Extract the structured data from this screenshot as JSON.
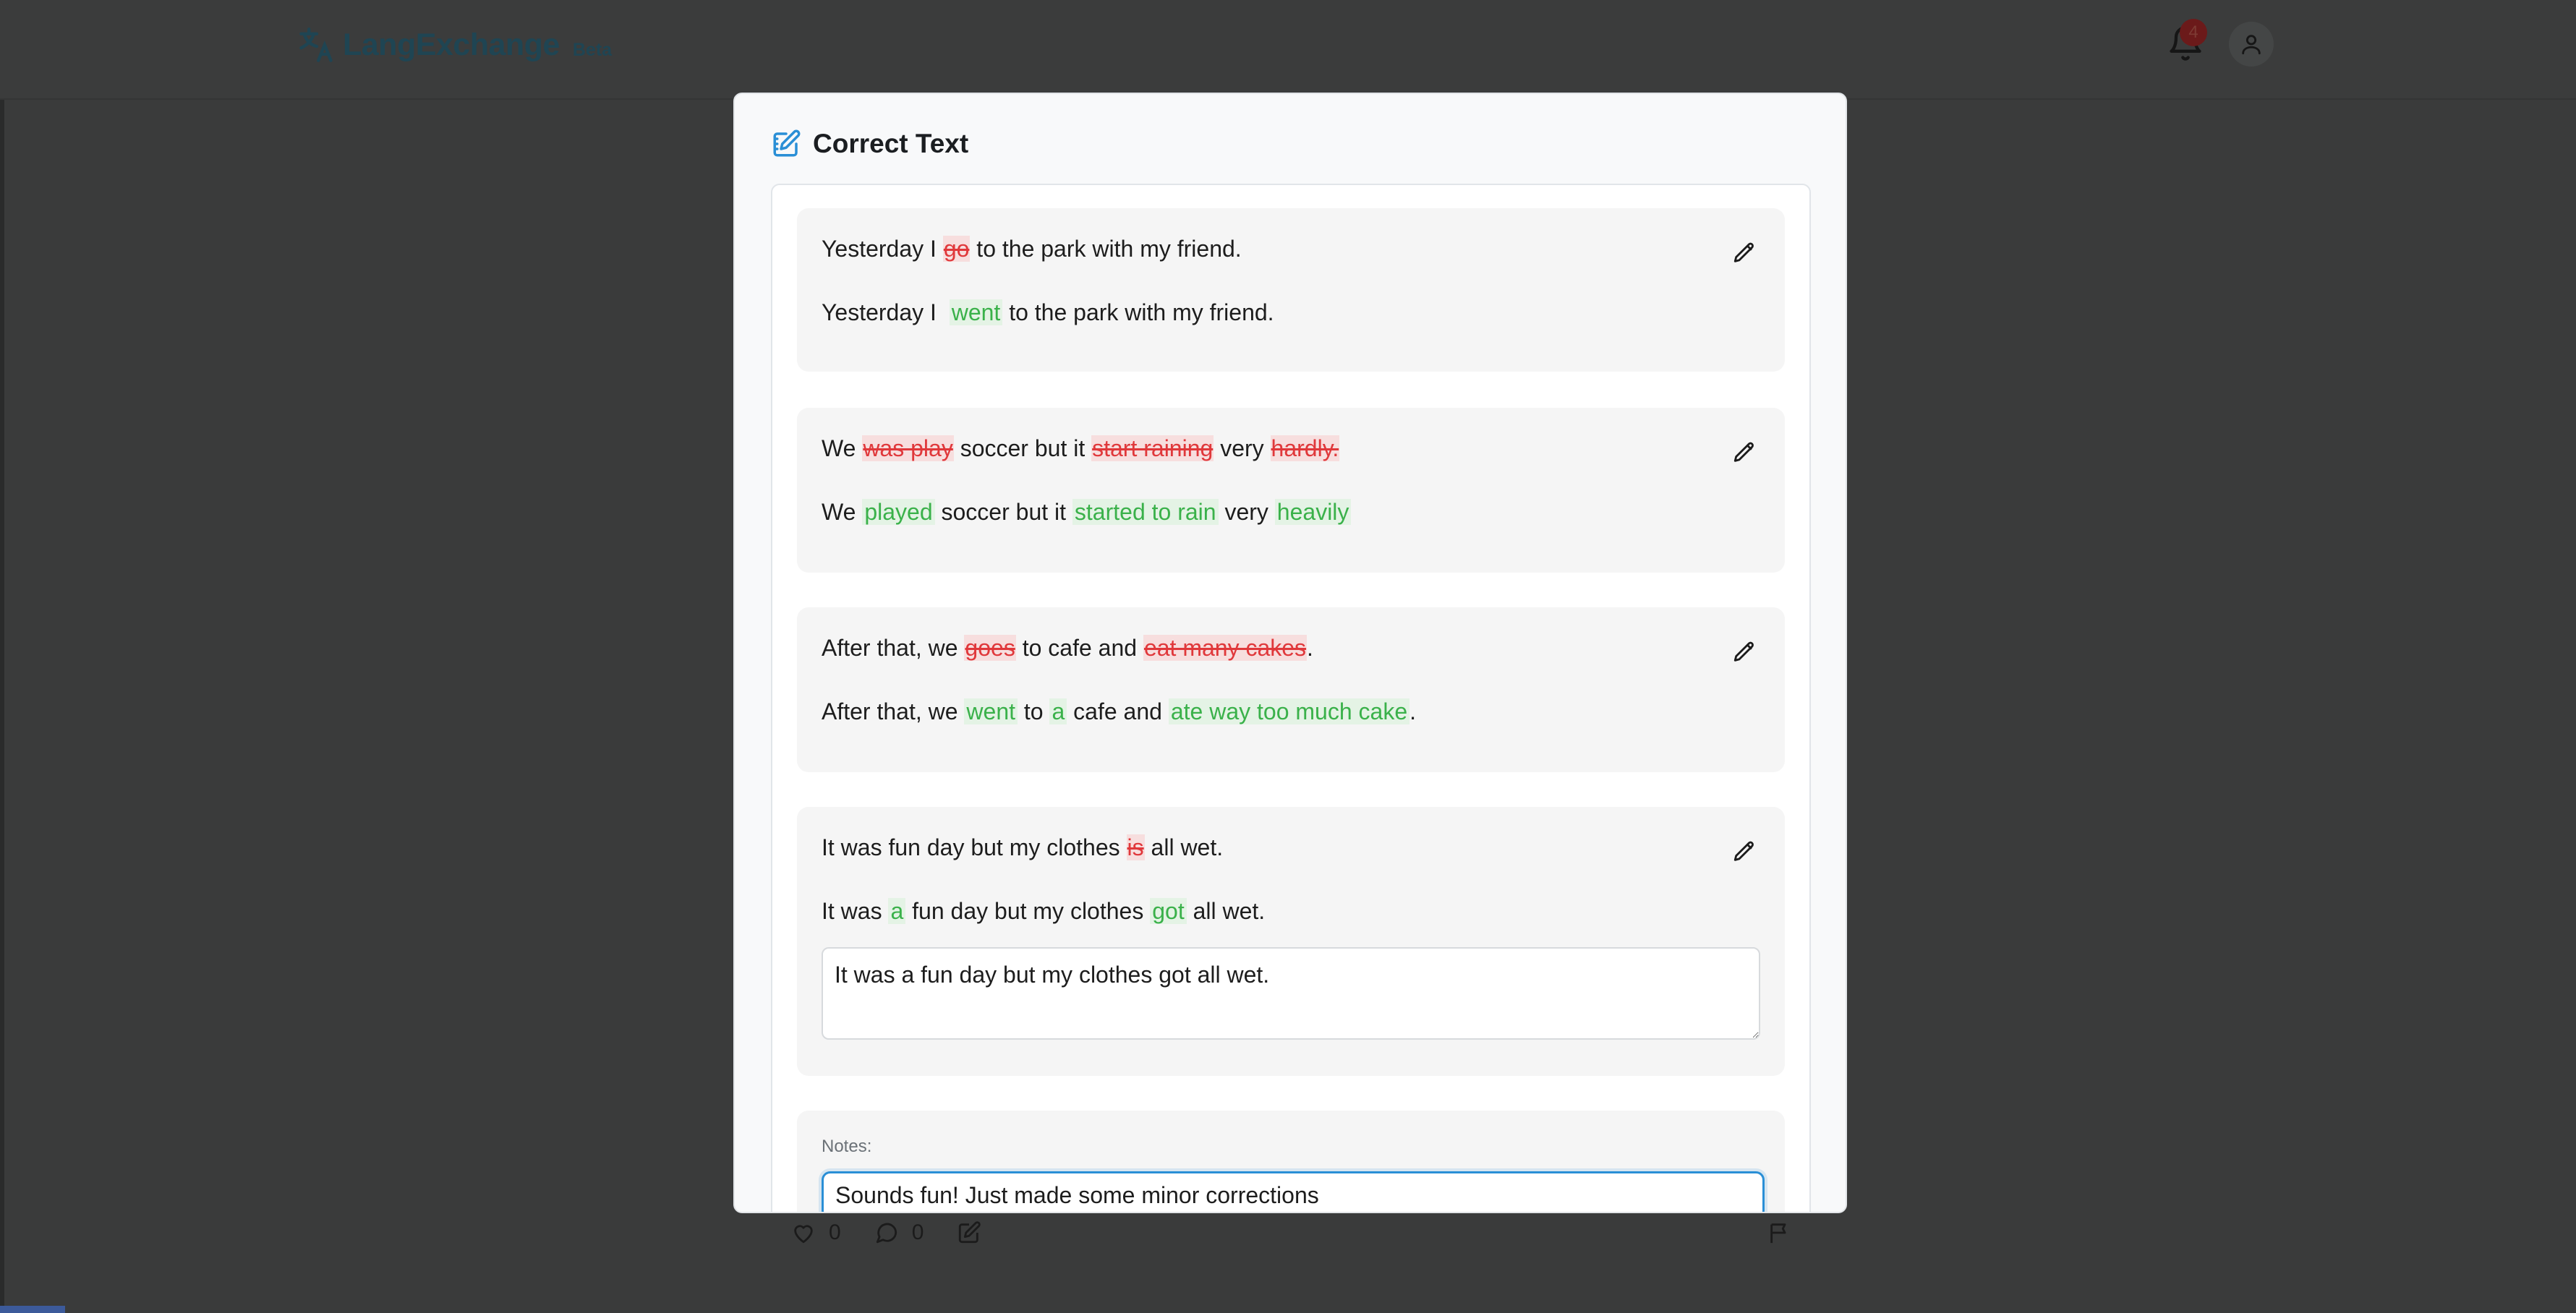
{
  "app": {
    "logo_name": "LangExchange",
    "logo_badge": "Beta",
    "notification_count": "4"
  },
  "post_actions": {
    "likes": "0",
    "comments": "0"
  },
  "modal": {
    "title": "Correct Text",
    "corrections": [
      {
        "original": [
          {
            "text": "Yesterday I "
          },
          {
            "text": "go",
            "type": "del"
          },
          {
            "text": " to the park with my friend."
          }
        ],
        "corrected": [
          {
            "text": "Yesterday I  "
          },
          {
            "text": "went",
            "type": "ins"
          },
          {
            "text": " to the park with my friend."
          }
        ]
      },
      {
        "original": [
          {
            "text": "We "
          },
          {
            "text": "was play",
            "type": "del"
          },
          {
            "text": " soccer but it "
          },
          {
            "text": "start raining",
            "type": "del"
          },
          {
            "text": " very "
          },
          {
            "text": "hardly.",
            "type": "del"
          }
        ],
        "corrected": [
          {
            "text": "We "
          },
          {
            "text": "played",
            "type": "ins"
          },
          {
            "text": " soccer but it "
          },
          {
            "text": "started to rain",
            "type": "ins"
          },
          {
            "text": " very "
          },
          {
            "text": "heavily",
            "type": "ins"
          }
        ]
      },
      {
        "original": [
          {
            "text": "After that, we "
          },
          {
            "text": "goes",
            "type": "del"
          },
          {
            "text": " to cafe and "
          },
          {
            "text": "eat many cakes",
            "type": "del"
          },
          {
            "text": "."
          }
        ],
        "corrected": [
          {
            "text": "After that, we "
          },
          {
            "text": "went",
            "type": "ins"
          },
          {
            "text": " to "
          },
          {
            "text": "a",
            "type": "ins"
          },
          {
            "text": " cafe and "
          },
          {
            "text": "ate way too much cake",
            "type": "ins"
          },
          {
            "text": "."
          }
        ]
      },
      {
        "original": [
          {
            "text": "It was fun day but my clothes "
          },
          {
            "text": "is",
            "type": "del"
          },
          {
            "text": " all wet."
          }
        ],
        "corrected": [
          {
            "text": "It was "
          },
          {
            "text": "a",
            "type": "ins"
          },
          {
            "text": " fun day but my clothes "
          },
          {
            "text": "got",
            "type": "ins"
          },
          {
            "text": " all wet."
          }
        ],
        "edit_value": "It was a fun day but my clothes got all wet."
      }
    ],
    "notes_label": "Notes:",
    "notes_value": "Sounds fun! Just made some minor corrections"
  }
}
